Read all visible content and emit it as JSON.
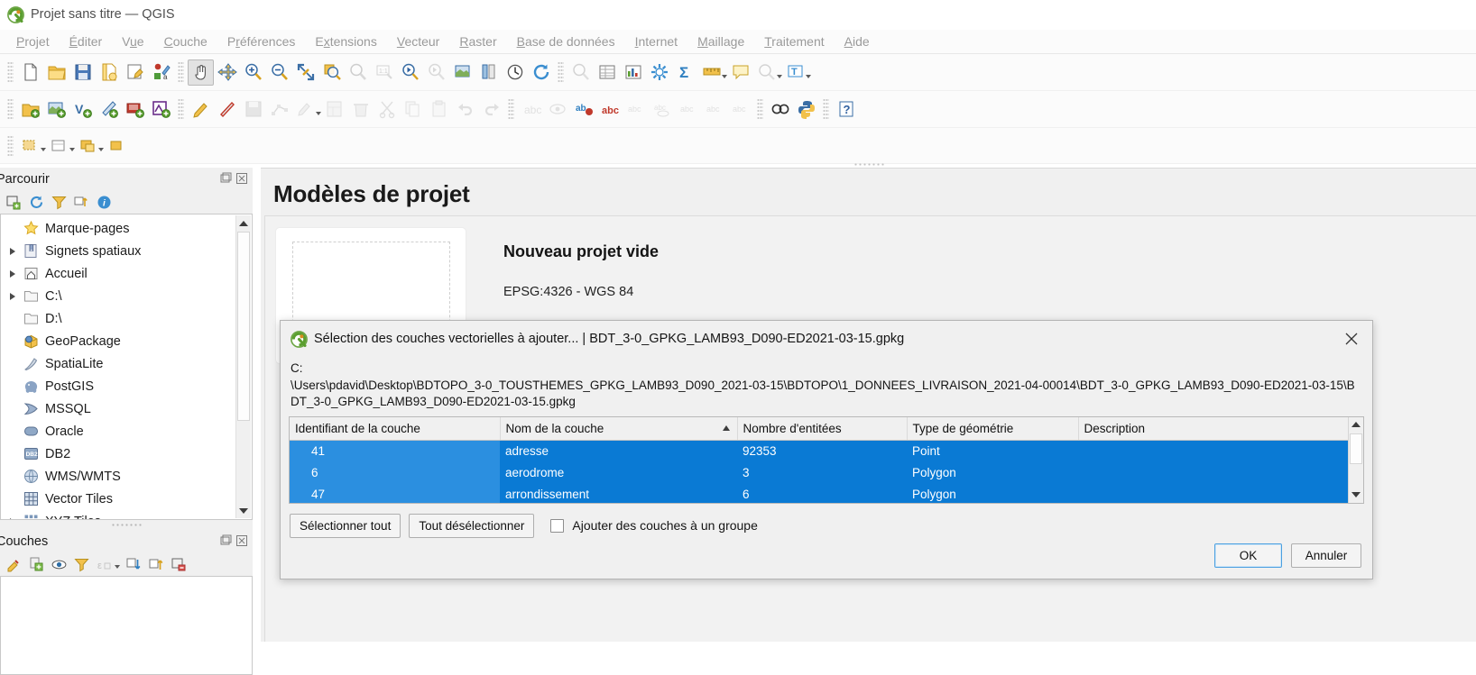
{
  "window": {
    "title": "Projet sans titre — QGIS",
    "logo_icon": "qgis-logo-icon"
  },
  "menubar": {
    "items": [
      {
        "label": "Projet",
        "mnemonic": "P"
      },
      {
        "label": "Éditer",
        "mnemonic": "É"
      },
      {
        "label": "Vue",
        "mnemonic": "u"
      },
      {
        "label": "Couche",
        "mnemonic": "C"
      },
      {
        "label": "Préférences",
        "mnemonic": "r"
      },
      {
        "label": "Extensions",
        "mnemonic": "x"
      },
      {
        "label": "Vecteur",
        "mnemonic": "V"
      },
      {
        "label": "Raster",
        "mnemonic": "R"
      },
      {
        "label": "Base de données",
        "mnemonic": "B"
      },
      {
        "label": "Internet",
        "mnemonic": "I"
      },
      {
        "label": "Maillage",
        "mnemonic": "M"
      },
      {
        "label": "Traitement",
        "mnemonic": "T"
      },
      {
        "label": "Aide",
        "mnemonic": "A"
      }
    ]
  },
  "toolbar_row1": {
    "icons": [
      "new-project-icon",
      "open-project-icon",
      "save-project-icon",
      "save-project-as-icon",
      "new-print-layout-icon",
      "style-manager-icon",
      "pan-map-icon",
      "pan-to-selection-icon",
      "zoom-in-icon",
      "zoom-out-icon",
      "zoom-full-icon",
      "zoom-to-selection-icon",
      "zoom-to-layer-icon",
      "zoom-native-icon",
      "zoom-last-icon",
      "zoom-next-icon",
      "new-map-view-icon",
      "new-3d-map-view-icon",
      "refresh-map-icon",
      "bookmark-icon",
      "clock-icon",
      "refresh-icon",
      "identify-features-icon",
      "open-attribute-table-icon",
      "statistical-summary-icon",
      "processing-toolbox-icon",
      "sum-icon",
      "measure-line-icon",
      "map-tips-icon",
      "deselect-icon",
      "text-annotation-icon"
    ]
  },
  "toolbar_row2": {
    "icons": [
      "add-vector-layer-icon",
      "add-raster-layer-icon",
      "add-mesh-layer-icon",
      "add-delimited-text-layer-icon",
      "add-spatialite-layer-icon",
      "add-wms-layer-icon",
      "toggle-editing-icon",
      "add-feature-icon",
      "save-layer-edits-icon",
      "vertex-tool-icon",
      "modify-attributes-icon",
      "open-field-calculator-icon",
      "delete-selected-icon",
      "cut-features-icon",
      "copy-features-icon",
      "paste-features-icon",
      "undo-icon",
      "redo-icon",
      "label-icon",
      "show-hide-labels-icon",
      "highlight-pinned-labels-icon",
      "pin-labels-icon",
      "show-unplaced-labels-icon",
      "move-label-icon",
      "rotate-label-icon",
      "change-label-icon",
      "show-all-labels-icon",
      "georeferencer-icon",
      "python-console-icon",
      "help-icon"
    ]
  },
  "toolbar_row3": {
    "icons": [
      "select-features-icon",
      "select-by-expression-icon",
      "open-table-icon",
      "new-shapefile-icon",
      "deselect-all-icon"
    ]
  },
  "browser_panel": {
    "title": "Parcourir",
    "float_icon": "float-panel-icon",
    "close_icon": "close-panel-icon",
    "toolbar_icons": [
      "add-layer-icon",
      "refresh-icon",
      "filter-browser-icon",
      "collapse-all-icon",
      "properties-info-icon"
    ],
    "items": [
      {
        "label": "Marque-pages",
        "icon": "star-icon",
        "expandable": false
      },
      {
        "label": "Signets spatiaux",
        "icon": "bookmarks-icon",
        "expandable": true
      },
      {
        "label": "Accueil",
        "icon": "home-icon",
        "expandable": true
      },
      {
        "label": "C:\\",
        "icon": "folder-icon",
        "expandable": true
      },
      {
        "label": "D:\\",
        "icon": "folder-icon",
        "expandable": false
      },
      {
        "label": "GeoPackage",
        "icon": "geopackage-icon",
        "expandable": false
      },
      {
        "label": "SpatiaLite",
        "icon": "spatialite-icon",
        "expandable": false
      },
      {
        "label": "PostGIS",
        "icon": "postgis-icon",
        "expandable": false
      },
      {
        "label": "MSSQL",
        "icon": "mssql-icon",
        "expandable": false
      },
      {
        "label": "Oracle",
        "icon": "oracle-icon",
        "expandable": false
      },
      {
        "label": "DB2",
        "icon": "db2-icon",
        "expandable": false
      },
      {
        "label": "WMS/WMTS",
        "icon": "wms-icon",
        "expandable": false
      },
      {
        "label": "Vector Tiles",
        "icon": "vector-tiles-icon",
        "expandable": false
      },
      {
        "label": "XYZ Tiles",
        "icon": "xyz-tiles-icon",
        "expandable": true
      }
    ]
  },
  "layers_panel": {
    "title": "Couches",
    "float_icon": "float-panel-icon",
    "close_icon": "close-panel-icon",
    "toolbar_icons": [
      "open-layer-styling-icon",
      "add-group-icon",
      "manage-visibility-icon",
      "filter-legend-icon",
      "filter-expression-icon",
      "expand-all-icon",
      "collapse-all-icon",
      "remove-layer-icon"
    ]
  },
  "main": {
    "heading": "Modèles de projet",
    "template": {
      "name": "Nouveau projet vide",
      "crs": "EPSG:4326 - WGS 84"
    }
  },
  "dialog": {
    "title": "Sélection des couches vectorielles à ajouter... | BDT_3-0_GPKG_LAMB93_D090-ED2021-03-15.gpkg",
    "logo_icon": "qgis-logo-icon",
    "close_icon": "close-icon",
    "path": "C:\n\\Users\\pdavid\\Desktop\\BDTOPO_3-0_TOUSTHEMES_GPKG_LAMB93_D090_2021-03-15\\BDTOPO\\1_DONNEES_LIVRAISON_2021-04-00014\\BDT_3-0_GPKG_LAMB93_D090-ED2021-03-15\\BDT_3-0_GPKG_LAMB93_D090-ED2021-03-15.gpkg",
    "table": {
      "columns": [
        {
          "label": "Identifiant de la couche",
          "sorted": false
        },
        {
          "label": "Nom de la couche",
          "sorted": true,
          "sort_dir": "asc"
        },
        {
          "label": "Nombre d'entitées",
          "sorted": false
        },
        {
          "label": "Type de géométrie",
          "sorted": false
        },
        {
          "label": "Description",
          "sorted": false
        }
      ],
      "rows": [
        {
          "id": "41",
          "name": "adresse",
          "count": "92353",
          "geometry": "Point",
          "description": "",
          "selected": true
        },
        {
          "id": "6",
          "name": "aerodrome",
          "count": "3",
          "geometry": "Polygon",
          "description": "",
          "selected": true
        },
        {
          "id": "47",
          "name": "arrondissement",
          "count": "6",
          "geometry": "Polygon",
          "description": "",
          "selected": true
        }
      ]
    },
    "controls": {
      "select_all": "Sélectionner tout",
      "deselect_all": "Tout désélectionner",
      "add_to_group_label": "Ajouter des couches à un groupe",
      "add_to_group_checked": false
    },
    "footer": {
      "ok": "OK",
      "cancel": "Annuler"
    }
  },
  "colors": {
    "selection_blue": "#0a7ad4",
    "selection_blue_light": "#2b8fe0",
    "panel_bg": "#f0f0f0",
    "accent_green": "#5a9e2f"
  }
}
